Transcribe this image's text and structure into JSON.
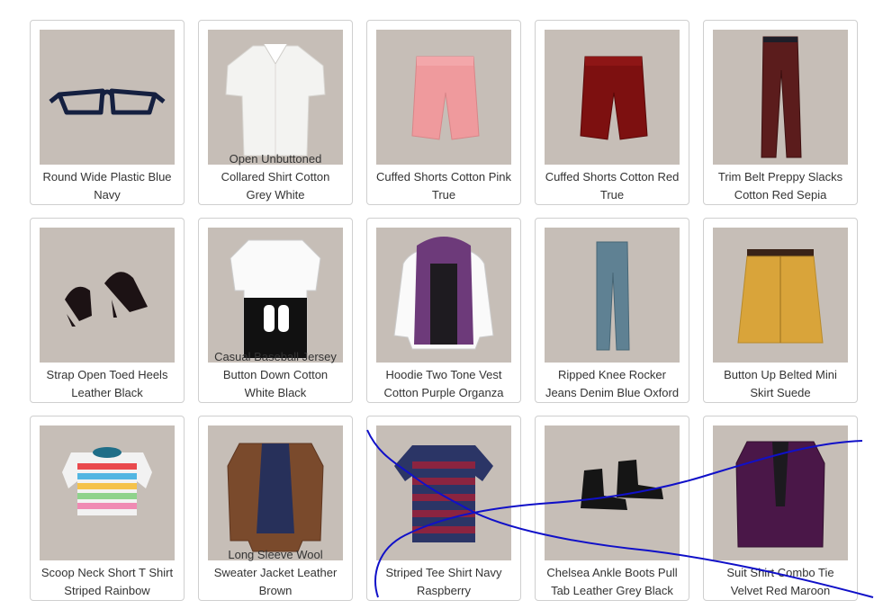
{
  "items": [
    {
      "lines": [
        "Round Wide Plastic Blue",
        "Navy"
      ],
      "icon": "glasses-icon"
    },
    {
      "lines": [
        "Open Unbuttoned",
        "Collared Shirt Cotton",
        "Grey White"
      ],
      "icon": "collared-shirt-icon"
    },
    {
      "lines": [
        "Cuffed Shorts Cotton Pink",
        "True"
      ],
      "icon": "pink-shorts-icon"
    },
    {
      "lines": [
        "Cuffed Shorts Cotton Red",
        "True"
      ],
      "icon": "red-shorts-icon"
    },
    {
      "lines": [
        "Trim Belt Preppy Slacks",
        "Cotton Red Sepia"
      ],
      "icon": "slacks-icon"
    },
    {
      "lines": [
        "Strap Open Toed Heels",
        "Leather Black"
      ],
      "icon": "heels-icon"
    },
    {
      "lines": [
        "Casual Baseball Jersey",
        "Button Down Cotton",
        "White Black"
      ],
      "icon": "baseball-jersey-icon"
    },
    {
      "lines": [
        "Hoodie Two Tone Vest",
        "Cotton Purple Organza"
      ],
      "icon": "hoodie-vest-icon"
    },
    {
      "lines": [
        "Ripped Knee Rocker",
        "Jeans Denim Blue Oxford"
      ],
      "icon": "ripped-jeans-icon"
    },
    {
      "lines": [
        "Button Up Belted Mini",
        "Skirt Suede"
      ],
      "icon": "mini-skirt-icon"
    },
    {
      "lines": [
        "Scoop Neck Short T Shirt",
        "Striped Rainbow"
      ],
      "icon": "rainbow-crop-top-icon"
    },
    {
      "lines": [
        "Long Sleeve Wool",
        "Sweater Jacket Leather",
        "Brown"
      ],
      "icon": "sweater-jacket-icon"
    },
    {
      "lines": [
        "Striped Tee Shirt Navy",
        "Raspberry"
      ],
      "icon": "striped-tee-icon"
    },
    {
      "lines": [
        "Chelsea Ankle Boots Pull",
        "Tab Leather Grey Black"
      ],
      "icon": "chelsea-boots-icon"
    },
    {
      "lines": [
        "Suit Shirt Combo Tie",
        "Velvet Red Maroon"
      ],
      "icon": "velvet-suit-icon"
    }
  ],
  "colors": {
    "thumb_bg": "#c6beb7",
    "annotation_stroke": "#1010c8"
  }
}
